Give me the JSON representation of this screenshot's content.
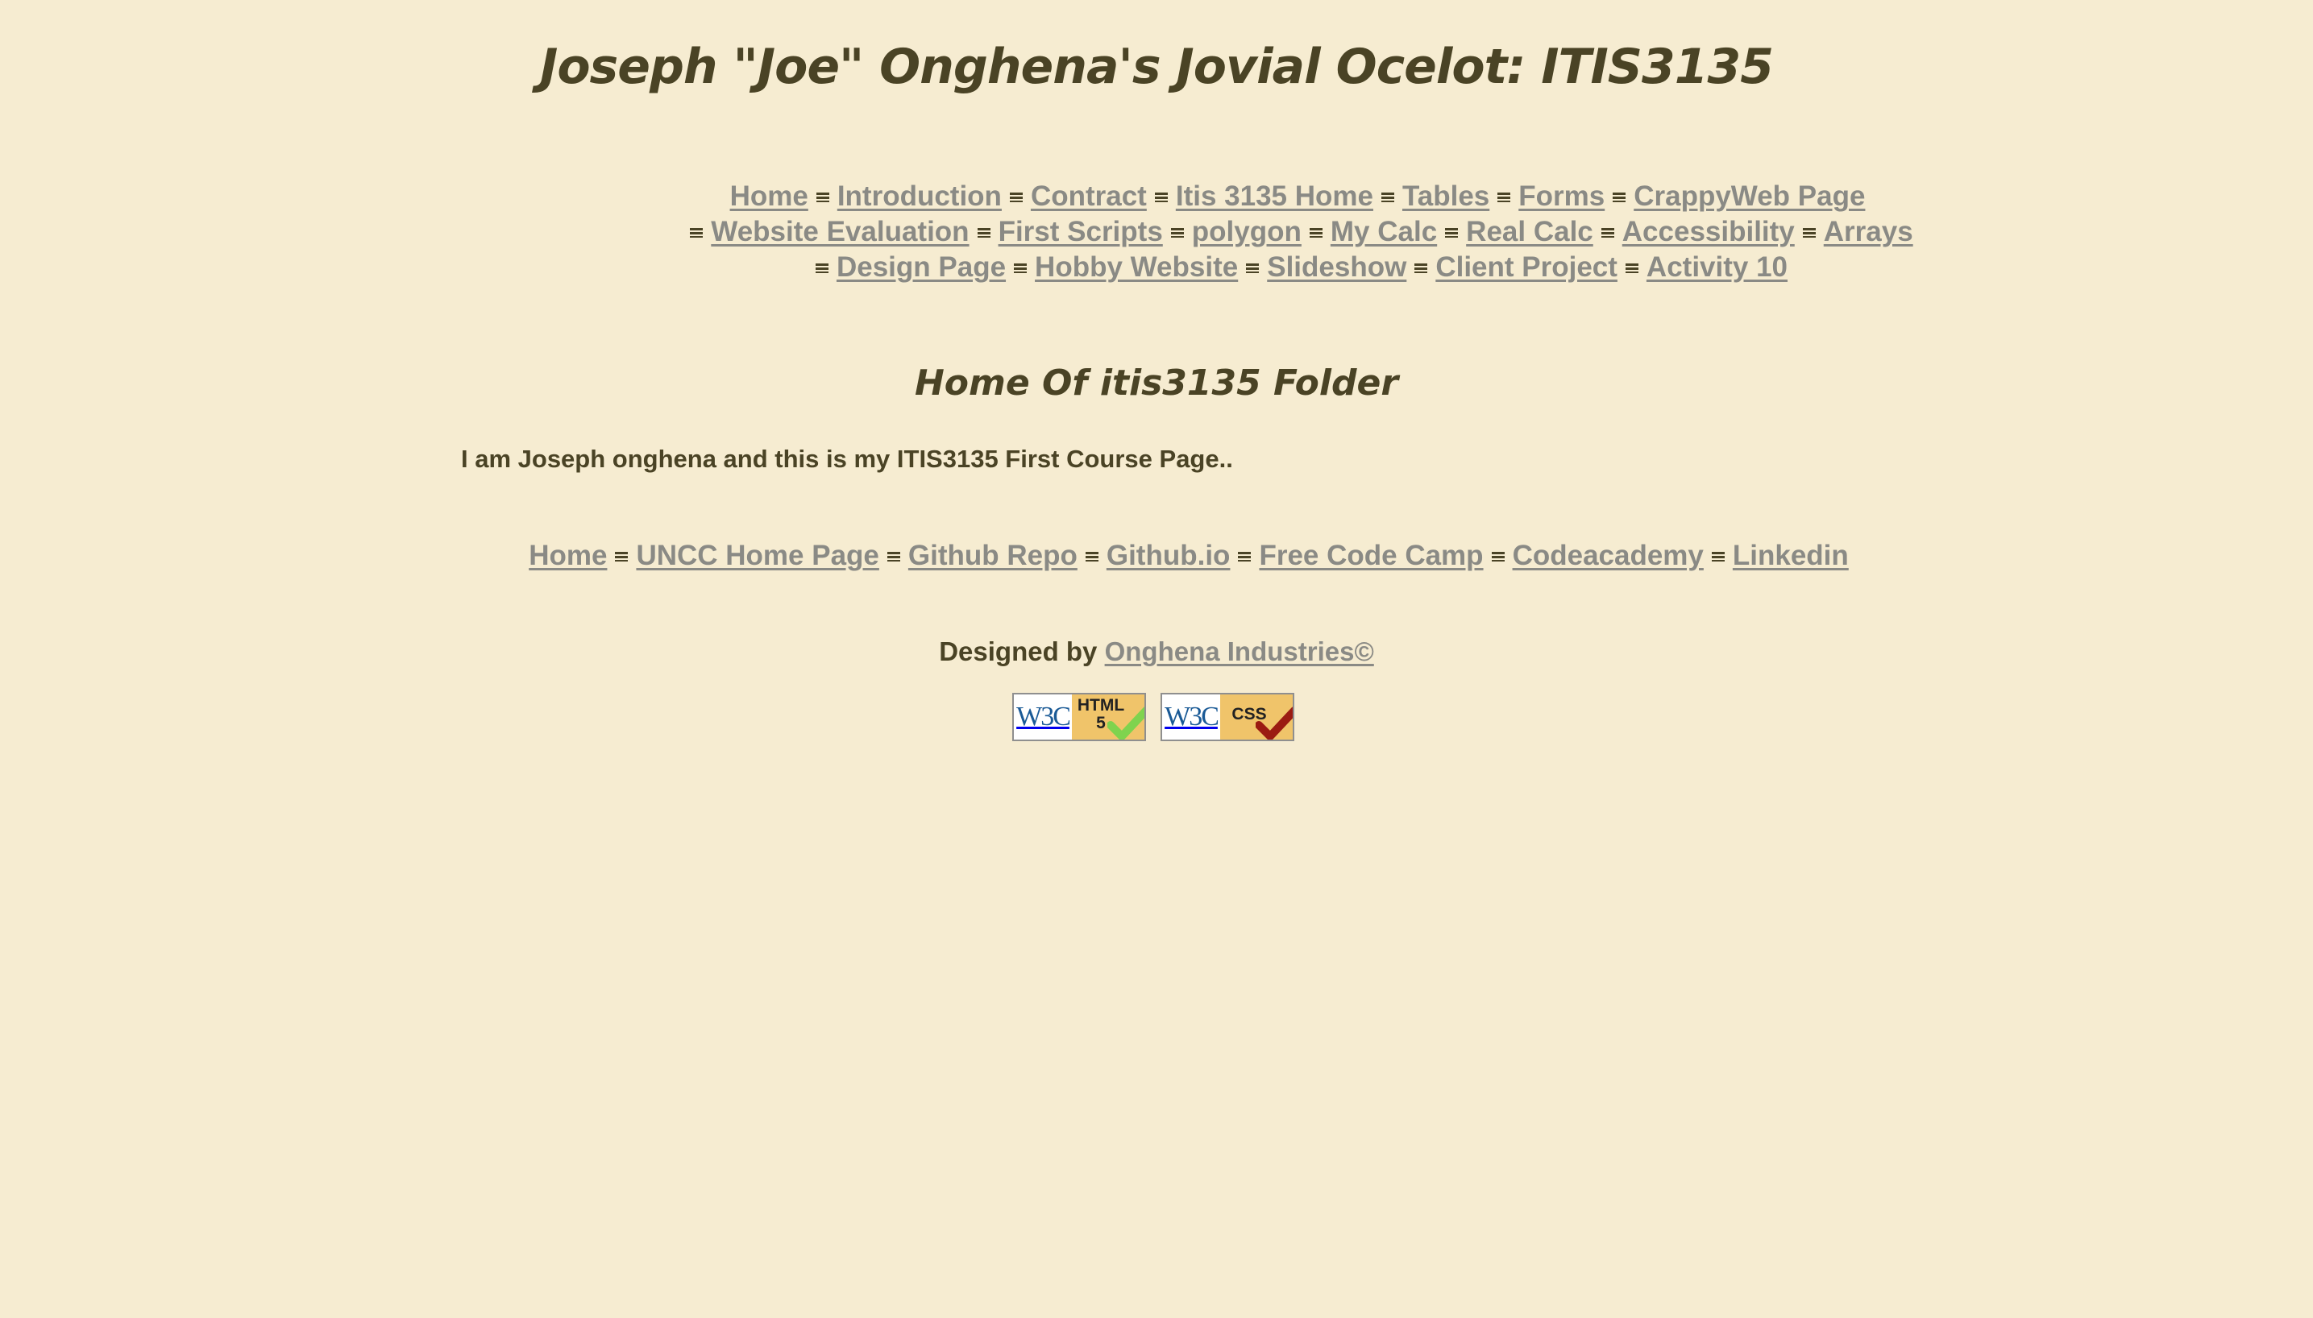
{
  "header": {
    "title": "Joseph \"Joe\" Onghena's Jovial Ocelot: ITIS3135"
  },
  "nav": {
    "lines": [
      [
        "Home",
        "Introduction",
        "Contract",
        "Itis 3135 Home",
        "Tables",
        "Forms",
        "CrappyWeb Page"
      ],
      [
        "Website Evaluation",
        "First Scripts",
        "polygon",
        "My Calc",
        "Real Calc",
        "Accessibility",
        "Arrays"
      ],
      [
        "Design Page",
        "Hobby Website",
        "Slideshow",
        "Client Project",
        "Activity 10"
      ]
    ]
  },
  "main": {
    "heading": "Home Of itis3135 Folder",
    "intro": "I am Joseph onghena and this is my ITIS3135 First Course Page.."
  },
  "footer": {
    "links": [
      "Home",
      "UNCC Home Page",
      "Github Repo",
      "Github.io",
      "Free Code Camp",
      "Codeacademy",
      "Linkedin"
    ],
    "credit_prefix": "Designed by",
    "credit_link": "Onghena Industries©",
    "badges": [
      {
        "left": "W3C",
        "tag": "HTML 5",
        "check_color": "#7fd34e",
        "icon": "w3c-html5-badge-icon"
      },
      {
        "left": "W3C",
        "tag": "CSS",
        "check_color": "#9b1b12",
        "icon": "w3c-css-badge-icon"
      }
    ]
  },
  "colors": {
    "background": "#f6ecd1",
    "text": "#4a4325",
    "link": "#8a8a85"
  }
}
